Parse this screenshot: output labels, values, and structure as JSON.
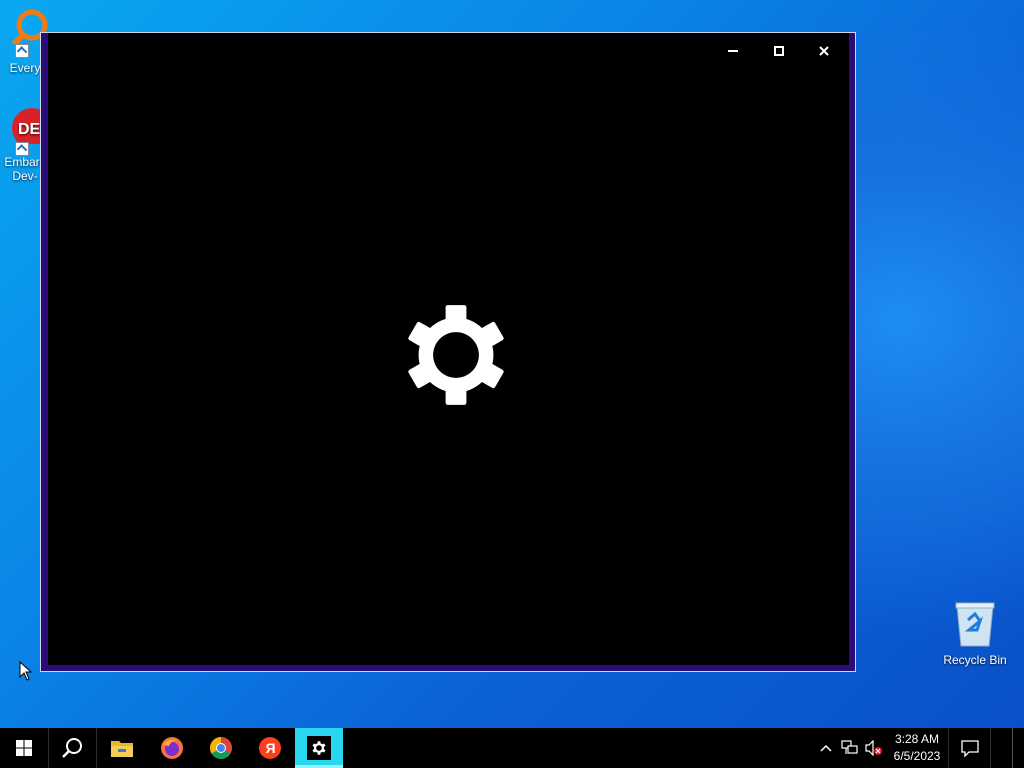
{
  "desktop": {
    "icons": [
      {
        "label": "Every",
        "icon": "everything-search-icon"
      },
      {
        "label": "Embarc Dev-",
        "line1": "Embarc",
        "line2": "Dev-",
        "icon": "embarcadero-dev-cpp-icon"
      },
      {
        "label": "Recycle Bin",
        "icon": "recycle-bin-icon"
      }
    ]
  },
  "window": {
    "title": "",
    "buttons": {
      "minimize": "minimize-icon",
      "maximize": "maximize-icon",
      "close": "close-icon"
    },
    "content_icon": "gear-icon",
    "colors": {
      "background": "#000000",
      "frame": "#2b0d7a",
      "gear": "#ffffff"
    }
  },
  "taskbar": {
    "buttons": [
      {
        "name": "start",
        "icon": "windows-start-icon"
      },
      {
        "name": "search",
        "icon": "search-icon"
      },
      {
        "name": "file-explorer",
        "icon": "folder-icon"
      },
      {
        "name": "firefox",
        "icon": "firefox-icon"
      },
      {
        "name": "chrome",
        "icon": "chrome-icon"
      },
      {
        "name": "yandex",
        "icon": "yandex-icon",
        "letter": "Я"
      },
      {
        "name": "settings",
        "icon": "gear-icon",
        "active": true
      }
    ],
    "tray": {
      "time": "3:28 AM",
      "date": "6/5/2023",
      "icons": [
        "chevron-up-icon",
        "network-icon",
        "volume-muted-icon",
        "notifications-icon"
      ]
    },
    "accent": "#29d6ef"
  }
}
